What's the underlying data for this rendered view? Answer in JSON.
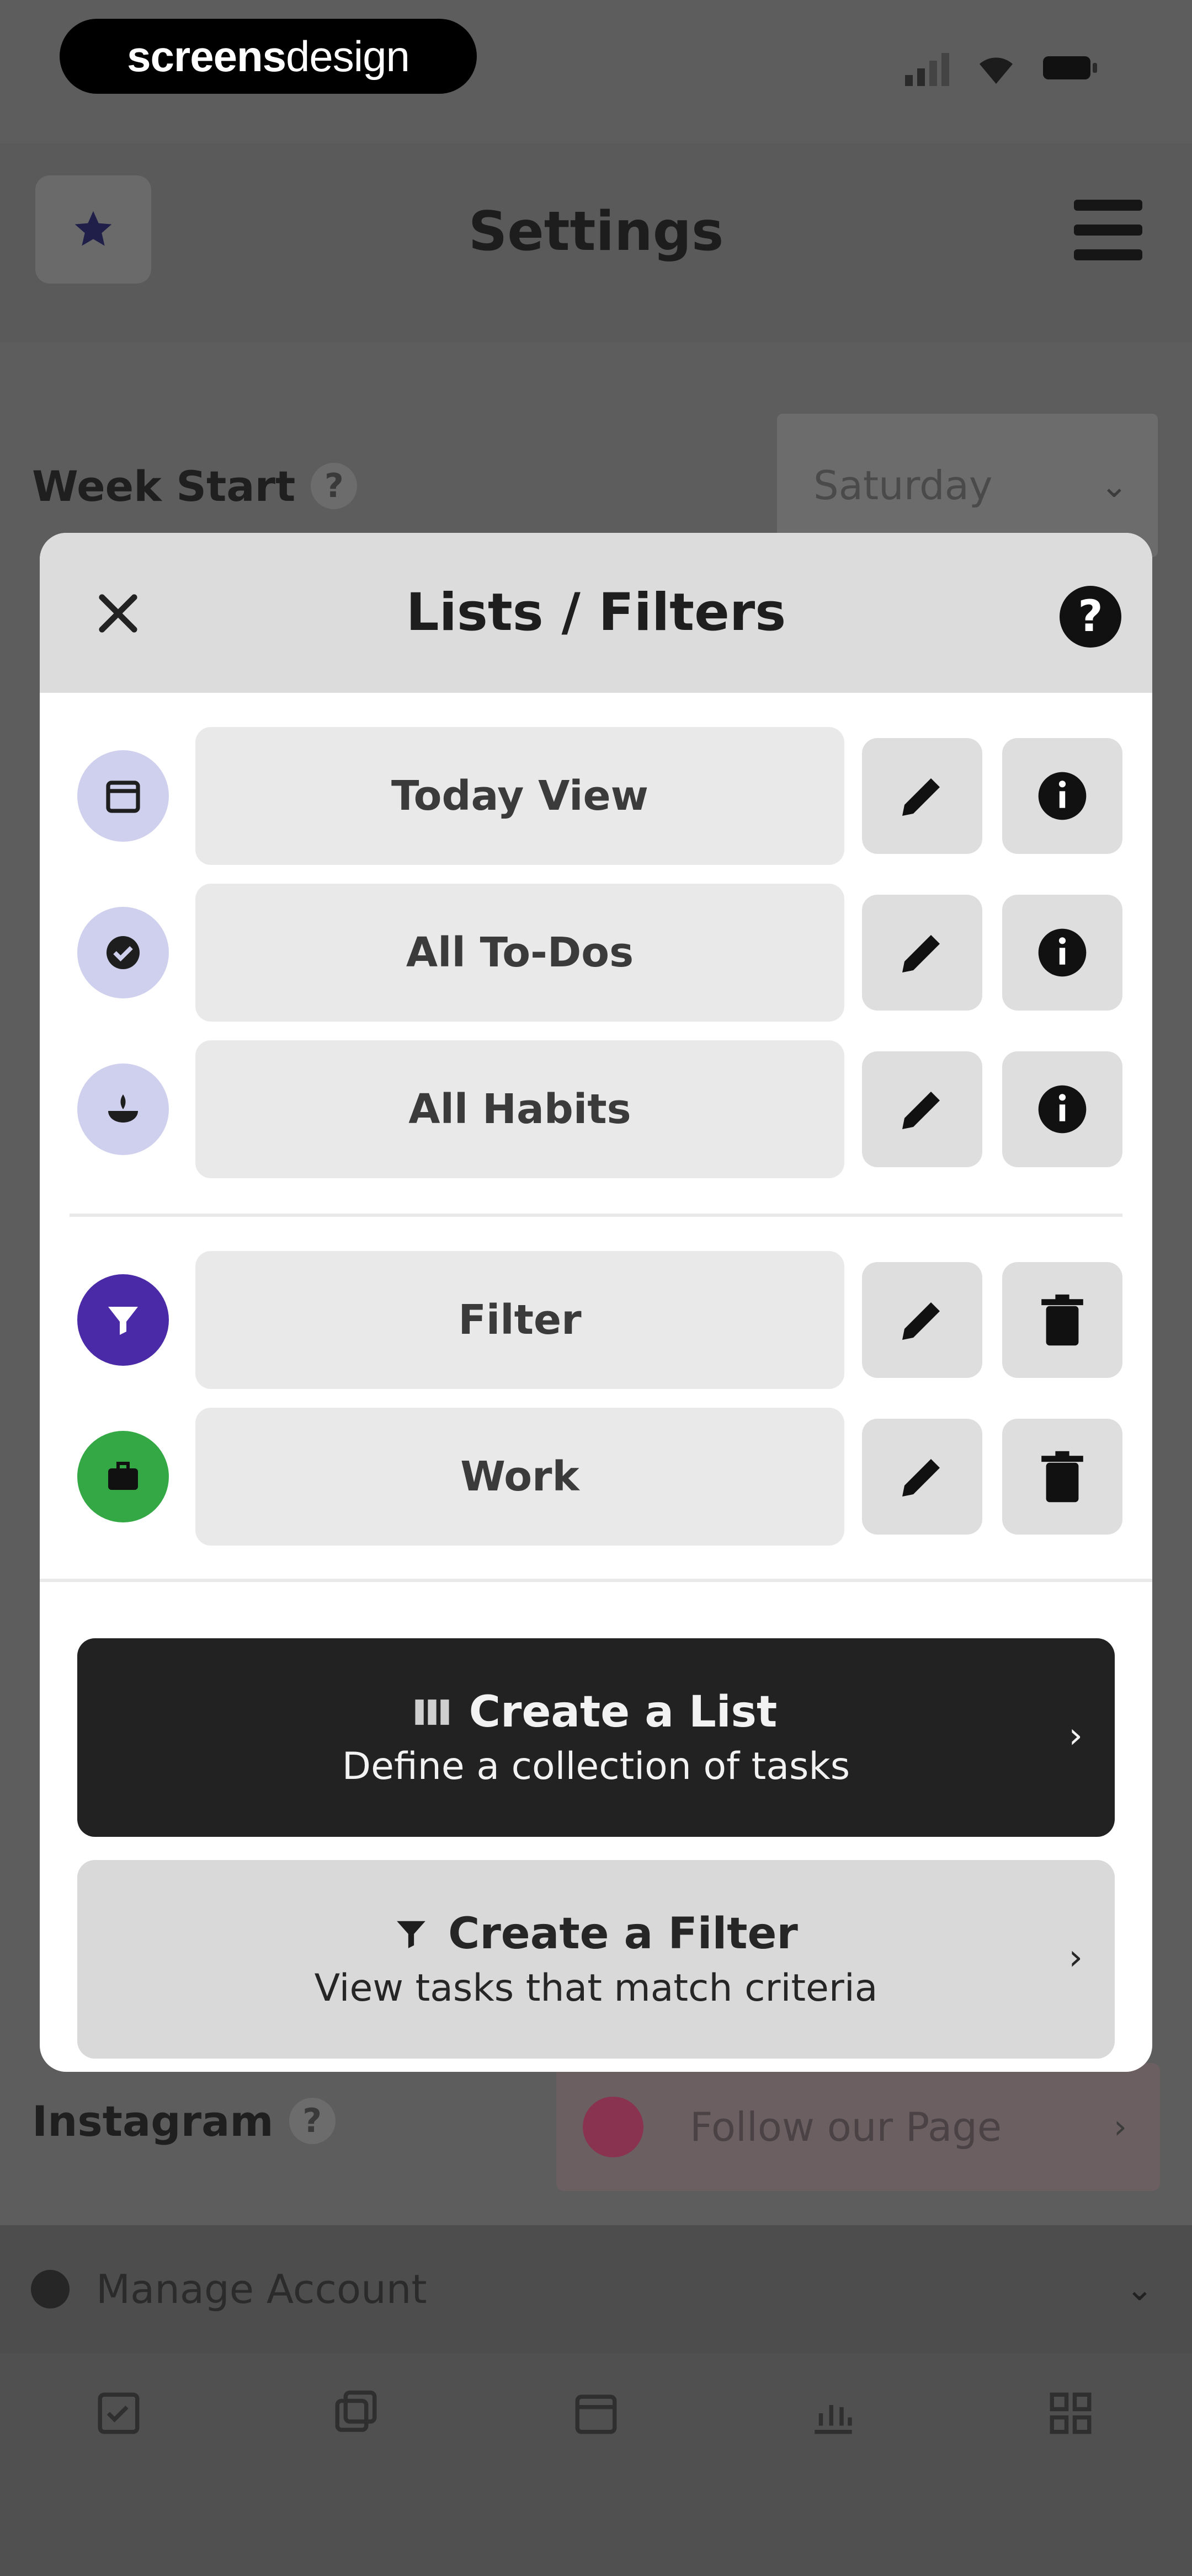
{
  "status_bar": {
    "logo_bold": "screens",
    "logo_light": "design"
  },
  "header": {
    "title": "Settings",
    "star_icon": "star-icon",
    "menu_icon": "hamburger-icon"
  },
  "settings": {
    "week_start_label": "Week Start",
    "week_start_value": "Saturday",
    "instagram_label": "Instagram",
    "instagram_button": "Follow our Page",
    "manage_account": "Manage Account"
  },
  "modal": {
    "title": "Lists / Filters",
    "default_lists": [
      {
        "name": "Today View",
        "icon": "calendar-icon"
      },
      {
        "name": "All To-Dos",
        "icon": "check-circle-icon"
      },
      {
        "name": "All Habits",
        "icon": "habit-icon"
      }
    ],
    "custom_lists": [
      {
        "name": "Filter",
        "icon": "filter-icon",
        "color": "#4a2aa6"
      },
      {
        "name": "Work",
        "icon": "briefcase-icon",
        "color": "#33a845"
      }
    ],
    "create_list": {
      "title": "Create a List",
      "subtitle": "Define a collection of tasks"
    },
    "create_filter": {
      "title": "Create a Filter",
      "subtitle": "View tasks that match criteria"
    }
  },
  "colors": {
    "modal_header": "#dcdcdc",
    "default_icon_bg": "#cfcfee",
    "primary_button": "#222222",
    "secondary_button": "#d9d9d9"
  }
}
